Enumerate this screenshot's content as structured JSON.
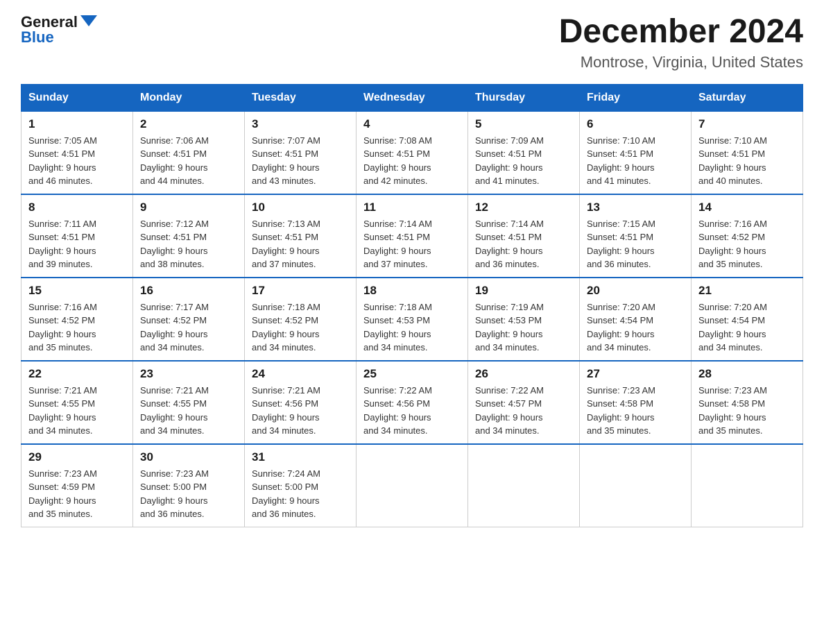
{
  "header": {
    "logo_general": "General",
    "logo_blue": "Blue",
    "month_title": "December 2024",
    "location": "Montrose, Virginia, United States"
  },
  "days_of_week": [
    "Sunday",
    "Monday",
    "Tuesday",
    "Wednesday",
    "Thursday",
    "Friday",
    "Saturday"
  ],
  "weeks": [
    [
      {
        "day": "1",
        "sunrise": "7:05 AM",
        "sunset": "4:51 PM",
        "daylight": "9 hours and 46 minutes."
      },
      {
        "day": "2",
        "sunrise": "7:06 AM",
        "sunset": "4:51 PM",
        "daylight": "9 hours and 44 minutes."
      },
      {
        "day": "3",
        "sunrise": "7:07 AM",
        "sunset": "4:51 PM",
        "daylight": "9 hours and 43 minutes."
      },
      {
        "day": "4",
        "sunrise": "7:08 AM",
        "sunset": "4:51 PM",
        "daylight": "9 hours and 42 minutes."
      },
      {
        "day": "5",
        "sunrise": "7:09 AM",
        "sunset": "4:51 PM",
        "daylight": "9 hours and 41 minutes."
      },
      {
        "day": "6",
        "sunrise": "7:10 AM",
        "sunset": "4:51 PM",
        "daylight": "9 hours and 41 minutes."
      },
      {
        "day": "7",
        "sunrise": "7:10 AM",
        "sunset": "4:51 PM",
        "daylight": "9 hours and 40 minutes."
      }
    ],
    [
      {
        "day": "8",
        "sunrise": "7:11 AM",
        "sunset": "4:51 PM",
        "daylight": "9 hours and 39 minutes."
      },
      {
        "day": "9",
        "sunrise": "7:12 AM",
        "sunset": "4:51 PM",
        "daylight": "9 hours and 38 minutes."
      },
      {
        "day": "10",
        "sunrise": "7:13 AM",
        "sunset": "4:51 PM",
        "daylight": "9 hours and 37 minutes."
      },
      {
        "day": "11",
        "sunrise": "7:14 AM",
        "sunset": "4:51 PM",
        "daylight": "9 hours and 37 minutes."
      },
      {
        "day": "12",
        "sunrise": "7:14 AM",
        "sunset": "4:51 PM",
        "daylight": "9 hours and 36 minutes."
      },
      {
        "day": "13",
        "sunrise": "7:15 AM",
        "sunset": "4:51 PM",
        "daylight": "9 hours and 36 minutes."
      },
      {
        "day": "14",
        "sunrise": "7:16 AM",
        "sunset": "4:52 PM",
        "daylight": "9 hours and 35 minutes."
      }
    ],
    [
      {
        "day": "15",
        "sunrise": "7:16 AM",
        "sunset": "4:52 PM",
        "daylight": "9 hours and 35 minutes."
      },
      {
        "day": "16",
        "sunrise": "7:17 AM",
        "sunset": "4:52 PM",
        "daylight": "9 hours and 34 minutes."
      },
      {
        "day": "17",
        "sunrise": "7:18 AM",
        "sunset": "4:52 PM",
        "daylight": "9 hours and 34 minutes."
      },
      {
        "day": "18",
        "sunrise": "7:18 AM",
        "sunset": "4:53 PM",
        "daylight": "9 hours and 34 minutes."
      },
      {
        "day": "19",
        "sunrise": "7:19 AM",
        "sunset": "4:53 PM",
        "daylight": "9 hours and 34 minutes."
      },
      {
        "day": "20",
        "sunrise": "7:20 AM",
        "sunset": "4:54 PM",
        "daylight": "9 hours and 34 minutes."
      },
      {
        "day": "21",
        "sunrise": "7:20 AM",
        "sunset": "4:54 PM",
        "daylight": "9 hours and 34 minutes."
      }
    ],
    [
      {
        "day": "22",
        "sunrise": "7:21 AM",
        "sunset": "4:55 PM",
        "daylight": "9 hours and 34 minutes."
      },
      {
        "day": "23",
        "sunrise": "7:21 AM",
        "sunset": "4:55 PM",
        "daylight": "9 hours and 34 minutes."
      },
      {
        "day": "24",
        "sunrise": "7:21 AM",
        "sunset": "4:56 PM",
        "daylight": "9 hours and 34 minutes."
      },
      {
        "day": "25",
        "sunrise": "7:22 AM",
        "sunset": "4:56 PM",
        "daylight": "9 hours and 34 minutes."
      },
      {
        "day": "26",
        "sunrise": "7:22 AM",
        "sunset": "4:57 PM",
        "daylight": "9 hours and 34 minutes."
      },
      {
        "day": "27",
        "sunrise": "7:23 AM",
        "sunset": "4:58 PM",
        "daylight": "9 hours and 35 minutes."
      },
      {
        "day": "28",
        "sunrise": "7:23 AM",
        "sunset": "4:58 PM",
        "daylight": "9 hours and 35 minutes."
      }
    ],
    [
      {
        "day": "29",
        "sunrise": "7:23 AM",
        "sunset": "4:59 PM",
        "daylight": "9 hours and 35 minutes."
      },
      {
        "day": "30",
        "sunrise": "7:23 AM",
        "sunset": "5:00 PM",
        "daylight": "9 hours and 36 minutes."
      },
      {
        "day": "31",
        "sunrise": "7:24 AM",
        "sunset": "5:00 PM",
        "daylight": "9 hours and 36 minutes."
      },
      null,
      null,
      null,
      null
    ]
  ],
  "labels": {
    "sunrise": "Sunrise:",
    "sunset": "Sunset:",
    "daylight": "Daylight:"
  }
}
